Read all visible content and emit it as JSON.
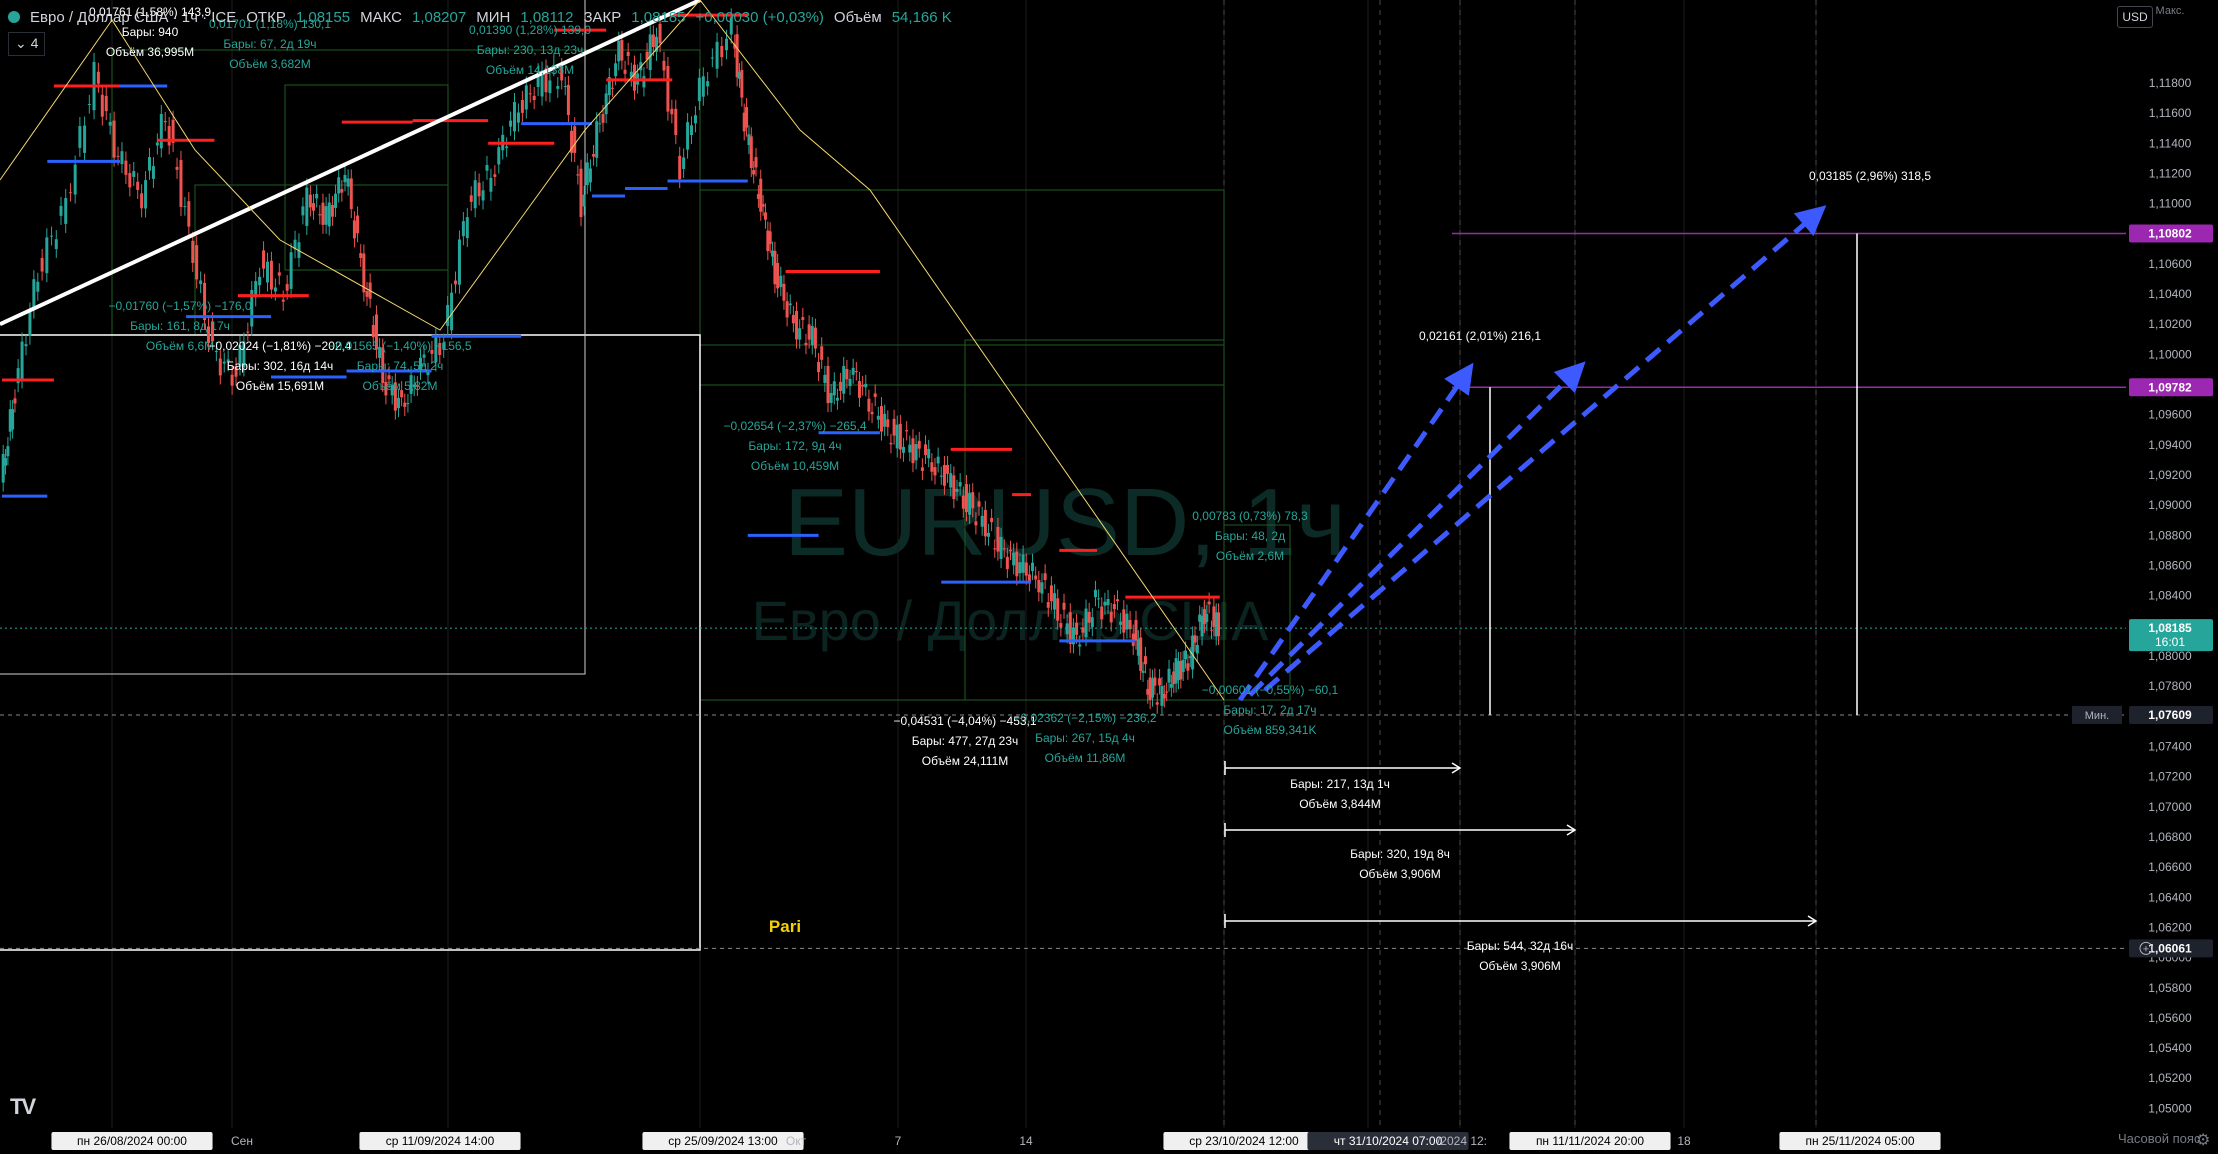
{
  "header": {
    "title": "Евро / Доллар США · 1ч · ICE",
    "open_label": "ОТКР",
    "open_value": "1,08155",
    "high_label": "МАКС",
    "high_value": "1,08207",
    "low_label": "МИН",
    "low_value": "1,08112",
    "close_label": "ЗАКР",
    "close_value": "1,08185",
    "change_value": "+0,00030 (+0,03%)",
    "volume_label": "Объём",
    "volume_value": "54,166 K",
    "indicator_count": "4"
  },
  "toolbar": {
    "currency": "USD",
    "timezone_label": "Часовой пояс",
    "gear_icon": "gear-icon",
    "logo": "TV"
  },
  "colors": {
    "background": "#000000",
    "bull": "#26a69a",
    "bear": "#ef5350",
    "resistance": "#ff1f1f",
    "support": "#2962ff",
    "projection": "#3d5afe",
    "level": "#9c27b0",
    "trendline": "#ffffff",
    "channel": "#f5d76e",
    "measure": "#1b5e20"
  },
  "chart_data": {
    "type": "candlestick",
    "symbol": "EURUSD, 1ч",
    "symbol_description": "Евро / Доллар США",
    "ylim": [
      1.0487,
      1.1235
    ],
    "y_ticks": [
      "1,11800",
      "1,11600",
      "1,11400",
      "1,11200",
      "1,11000",
      "1,10800",
      "1,10600",
      "1,10400",
      "1,10200",
      "1,10000",
      "1,09800",
      "1,09600",
      "1,09400",
      "1,09200",
      "1,09000",
      "1,08800",
      "1,08600",
      "1,08400",
      "1,08200",
      "1,08000",
      "1,07800",
      "1,07600",
      "1,07400",
      "1,07200",
      "1,07000",
      "1,06800",
      "1,06600",
      "1,06400",
      "1,06200",
      "1,06000",
      "1,05800",
      "1,05600",
      "1,05400",
      "1,05200",
      "1,05000"
    ],
    "axis_top_label": "Макс.",
    "price_labels": [
      {
        "value": "1,10802",
        "price": 1.10802,
        "kind": "level"
      },
      {
        "value": "1,09782",
        "price": 1.09782,
        "kind": "level"
      },
      {
        "value": "1,08185",
        "sub": "16:01",
        "price": 1.08185,
        "kind": "last"
      },
      {
        "value": "1,07609",
        "price": 1.07609,
        "kind": "min",
        "tag": "Мин."
      },
      {
        "value": "1,06061",
        "price": 1.06061,
        "kind": "cross"
      }
    ],
    "time_labels": [
      {
        "text": "пн 26/08/2024   00:00",
        "boxed": true
      },
      {
        "text": "Сен",
        "boxed": false
      },
      {
        "text": "ср 11/09/2024   14:00",
        "boxed": true
      },
      {
        "text": "ср 25/09/2024   13:00",
        "boxed": true
      },
      {
        "text": "Окт",
        "boxed": false
      },
      {
        "text": "7",
        "boxed": false
      },
      {
        "text": "14",
        "boxed": false
      },
      {
        "text": "ср 23/10/2024   12:00",
        "boxed": true
      },
      {
        "text": "чт 31/10/2024   07:00",
        "boxed": true,
        "dark": true
      },
      {
        "text": "/2024   12:",
        "boxed": false
      },
      {
        "text": "пн 11/11/2024   20:00",
        "boxed": true
      },
      {
        "text": "18",
        "boxed": false
      },
      {
        "text": "пн 25/11/2024   05:00",
        "boxed": true
      }
    ],
    "path_points": [
      [
        0,
        1.0915
      ],
      [
        15,
        1.0975
      ],
      [
        40,
        1.1055
      ],
      [
        70,
        1.11
      ],
      [
        100,
        1.1185
      ],
      [
        125,
        1.113
      ],
      [
        150,
        1.1105
      ],
      [
        175,
        1.116
      ],
      [
        200,
        1.108
      ],
      [
        225,
        1.1
      ],
      [
        250,
        1.0985
      ],
      [
        275,
        1.106
      ],
      [
        300,
        1.104
      ],
      [
        325,
        1.1105
      ],
      [
        345,
        1.109
      ],
      [
        365,
        1.112
      ],
      [
        385,
        1.105
      ],
      [
        405,
        1.0985
      ],
      [
        425,
        1.0965
      ],
      [
        445,
        1.099
      ],
      [
        470,
        1.101
      ],
      [
        495,
        1.11
      ],
      [
        520,
        1.112
      ],
      [
        545,
        1.116
      ],
      [
        570,
        1.118
      ],
      [
        595,
        1.1185
      ],
      [
        615,
        1.11
      ],
      [
        635,
        1.1155
      ],
      [
        655,
        1.12
      ],
      [
        675,
        1.118
      ],
      [
        695,
        1.1215
      ],
      [
        720,
        1.1125
      ],
      [
        745,
        1.1185
      ],
      [
        775,
        1.1215
      ],
      [
        790,
        1.1145
      ],
      [
        805,
        1.11
      ],
      [
        820,
        1.1055
      ],
      [
        840,
        1.102
      ],
      [
        860,
        1.101
      ],
      [
        880,
        1.097
      ],
      [
        900,
        1.099
      ],
      [
        920,
        1.097
      ],
      [
        940,
        1.095
      ],
      [
        960,
        1.094
      ],
      [
        980,
        1.093
      ],
      [
        1000,
        1.092
      ],
      [
        1020,
        1.0905
      ],
      [
        1040,
        1.089
      ],
      [
        1060,
        1.087
      ],
      [
        1080,
        1.086
      ],
      [
        1100,
        1.085
      ],
      [
        1120,
        1.083
      ],
      [
        1140,
        1.081
      ],
      [
        1160,
        1.0835
      ],
      [
        1180,
        1.083
      ],
      [
        1200,
        1.0815
      ],
      [
        1215,
        1.078
      ],
      [
        1230,
        1.0775
      ],
      [
        1245,
        1.079
      ],
      [
        1260,
        1.08
      ],
      [
        1275,
        1.083
      ],
      [
        1290,
        1.0818
      ]
    ],
    "resistance_levels": [
      {
        "x1": 0,
        "x2": 55,
        "price": 1.0983
      },
      [
        0,
        0
      ],
      {
        "x1": 55,
        "x2": 130,
        "price": 1.1178
      },
      {
        "x1": 165,
        "x2": 225,
        "price": 1.1142
      },
      {
        "x1": 250,
        "x2": 325,
        "price": 1.1039
      },
      {
        "x1": 360,
        "x2": 435,
        "price": 1.1154
      },
      {
        "x1": 435,
        "x2": 515,
        "price": 1.1155
      },
      {
        "x1": 515,
        "x2": 585,
        "price": 1.114
      },
      {
        "x1": 585,
        "x2": 640,
        "price": 1.1215
      },
      {
        "x1": 640,
        "x2": 710,
        "price": 1.1182
      },
      {
        "x1": 705,
        "x2": 790,
        "price": 1.1225
      },
      {
        "x1": 830,
        "x2": 930,
        "price": 1.1055
      },
      {
        "x1": 930,
        "x2": 990,
        "price": 0.0
      },
      {
        "x1": 1005,
        "x2": 1070,
        "price": 1.0937
      },
      {
        "x1": 1070,
        "x2": 1090,
        "price": 1.0907
      },
      {
        "x1": 1120,
        "x2": 1160,
        "price": 1.087
      },
      {
        "x1": 1190,
        "x2": 1290,
        "price": 1.0839
      }
    ],
    "support_levels": [
      {
        "x1": 0,
        "x2": 48,
        "price": 1.0906
      },
      {
        "x1": 48,
        "x2": 125,
        "price": 1.1128
      },
      {
        "x1": 125,
        "x2": 175,
        "price": 1.1178
      },
      {
        "x1": 195,
        "x2": 285,
        "price": 1.1025
      },
      {
        "x1": 285,
        "x2": 365,
        "price": 1.0985
      },
      {
        "x1": 365,
        "x2": 455,
        "price": 1.0989
      },
      {
        "x1": 455,
        "x2": 550,
        "price": 1.1012
      },
      {
        "x1": 550,
        "x2": 625,
        "price": 1.1153
      },
      {
        "x1": 625,
        "x2": 660,
        "price": 1.1105
      },
      {
        "x1": 660,
        "x2": 705,
        "price": 1.111
      },
      {
        "x1": 705,
        "x2": 790,
        "price": 1.1115
      },
      {
        "x1": 790,
        "x2": 865,
        "price": 1.088
      },
      {
        "x1": 865,
        "x2": 930,
        "price": 1.0948
      },
      {
        "x1": 995,
        "x2": 1090,
        "price": 1.0849
      },
      {
        "x1": 1120,
        "x2": 1200,
        "price": 1.081
      }
    ],
    "measures": [
      {
        "lines": [
          "0,01761 (1,58%) 143,9",
          "Бары: 940",
          "Объём 36,995M"
        ]
      },
      {
        "lines": [
          "0,01701 (1,18%) 130,1",
          "Бары: 67, 2д 19ч",
          "Объём 3,682M"
        ]
      },
      {
        "lines": [
          "0,01390 (1,28%) 139,0",
          "Бары: 230, 13д 23ч",
          "Объём 14,138M"
        ]
      },
      {
        "lines": [
          "−0,01760 (−1,57%) −176,0",
          "Бары: 161, 8д 17ч",
          "Объём 6,6M"
        ]
      },
      {
        "lines": [
          "−0,02024 (−1,81%) −202,4",
          "Бары: 302, 16д 14ч",
          "Объём 15,691M"
        ]
      },
      {
        "lines": [
          "−0,01565 (−1,40%) −156,5",
          "Бары: 74, 5д 2ч",
          "Объём 5,82M"
        ]
      },
      {
        "lines": [
          "−0,02654 (−2,37%) −265,4",
          "Бары: 172, 9д 4ч",
          "Объём 10,459M"
        ]
      },
      {
        "lines": [
          "−0,04531 (−4,04%) −453,1",
          "Бары: 477, 27д 23ч",
          "Объём 24,111M"
        ]
      },
      {
        "lines": [
          "−0,02362 (−2,15%) −236,2",
          "Бары: 267, 15д 4ч",
          "Объём 11,86M"
        ]
      },
      {
        "lines": [
          "0,00783 (0,73%) 78,3",
          "Бары: 48, 2д",
          "Объём 2,6M"
        ]
      },
      {
        "lines": [
          "−0,00601 (−0,55%) −60,1",
          "Бары: 17, 2д 17ч",
          "Объём 859,341K"
        ]
      },
      {
        "lines": [
          "Бары: 217, 13д 1ч",
          "Объём 3,844M"
        ]
      },
      {
        "lines": [
          "Бары: 320, 19д 8ч",
          "Объём 3,906M"
        ]
      },
      {
        "lines": [
          "Бары: 544, 32д 16ч",
          "Объём 3,906M"
        ]
      },
      {
        "lines": [
          "0,02161 (2,01%) 216,1"
        ]
      },
      {
        "lines": [
          "0,03185 (2,96%) 318,5"
        ]
      }
    ],
    "annotation_pari": "Pari",
    "watermark": {
      "line1": "EURUSD, 1ч",
      "line2": "Евро / Доллар США"
    }
  }
}
